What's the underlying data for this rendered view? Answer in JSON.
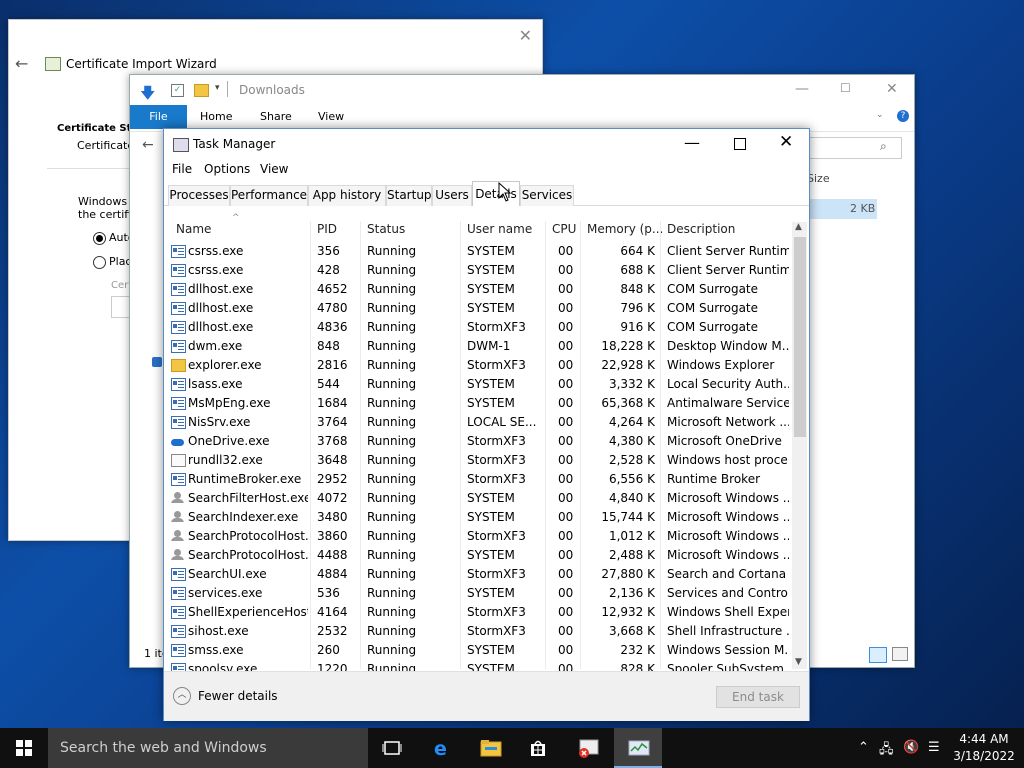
{
  "wizard": {
    "title": "Certificate Import Wizard",
    "store_heading": "Certificate Stor",
    "store_sub": "Certificate",
    "desc1": "Windows c",
    "desc2": "the certific",
    "option_auto": "Auto",
    "option_place": "Place",
    "cert_label": "Cert"
  },
  "explorer": {
    "title": "Downloads",
    "tabs": [
      "File",
      "Home",
      "Share",
      "View"
    ],
    "size_header": "Size",
    "size_value": "2 KB",
    "status": "1 ite"
  },
  "taskmanager": {
    "title": "Task Manager",
    "menu": [
      "File",
      "Options",
      "View"
    ],
    "tabs": [
      "Processes",
      "Performance",
      "App history",
      "Startup",
      "Users",
      "Details",
      "Services"
    ],
    "active_tab": "Details",
    "columns": [
      "Name",
      "PID",
      "Status",
      "User name",
      "CPU",
      "Memory (p...",
      "Description"
    ],
    "rows": [
      {
        "name": "csrss.exe",
        "pid": "356",
        "status": "Running",
        "user": "SYSTEM",
        "cpu": "00",
        "mem": "664 K",
        "desc": "Client Server Runtim...",
        "icon": "window"
      },
      {
        "name": "csrss.exe",
        "pid": "428",
        "status": "Running",
        "user": "SYSTEM",
        "cpu": "00",
        "mem": "688 K",
        "desc": "Client Server Runtim...",
        "icon": "window"
      },
      {
        "name": "dllhost.exe",
        "pid": "4652",
        "status": "Running",
        "user": "SYSTEM",
        "cpu": "00",
        "mem": "848 K",
        "desc": "COM Surrogate",
        "icon": "window"
      },
      {
        "name": "dllhost.exe",
        "pid": "4780",
        "status": "Running",
        "user": "SYSTEM",
        "cpu": "00",
        "mem": "796 K",
        "desc": "COM Surrogate",
        "icon": "window"
      },
      {
        "name": "dllhost.exe",
        "pid": "4836",
        "status": "Running",
        "user": "StormXF3",
        "cpu": "00",
        "mem": "916 K",
        "desc": "COM Surrogate",
        "icon": "window"
      },
      {
        "name": "dwm.exe",
        "pid": "848",
        "status": "Running",
        "user": "DWM-1",
        "cpu": "00",
        "mem": "18,228 K",
        "desc": "Desktop Window M...",
        "icon": "window"
      },
      {
        "name": "explorer.exe",
        "pid": "2816",
        "status": "Running",
        "user": "StormXF3",
        "cpu": "00",
        "mem": "22,928 K",
        "desc": "Windows Explorer",
        "icon": "explorer"
      },
      {
        "name": "lsass.exe",
        "pid": "544",
        "status": "Running",
        "user": "SYSTEM",
        "cpu": "00",
        "mem": "3,332 K",
        "desc": "Local Security Auth...",
        "icon": "window"
      },
      {
        "name": "MsMpEng.exe",
        "pid": "1684",
        "status": "Running",
        "user": "SYSTEM",
        "cpu": "00",
        "mem": "65,368 K",
        "desc": "Antimalware Service...",
        "icon": "window"
      },
      {
        "name": "NisSrv.exe",
        "pid": "3764",
        "status": "Running",
        "user": "LOCAL SE...",
        "cpu": "00",
        "mem": "4,264 K",
        "desc": "Microsoft Network ...",
        "icon": "window"
      },
      {
        "name": "OneDrive.exe",
        "pid": "3768",
        "status": "Running",
        "user": "StormXF3",
        "cpu": "00",
        "mem": "4,380 K",
        "desc": "Microsoft OneDrive",
        "icon": "cloud"
      },
      {
        "name": "rundll32.exe",
        "pid": "3648",
        "status": "Running",
        "user": "StormXF3",
        "cpu": "00",
        "mem": "2,528 K",
        "desc": "Windows host proce...",
        "icon": "doc"
      },
      {
        "name": "RuntimeBroker.exe",
        "pid": "2952",
        "status": "Running",
        "user": "StormXF3",
        "cpu": "00",
        "mem": "6,556 K",
        "desc": "Runtime Broker",
        "icon": "window"
      },
      {
        "name": "SearchFilterHost.exe",
        "pid": "4072",
        "status": "Running",
        "user": "SYSTEM",
        "cpu": "00",
        "mem": "4,840 K",
        "desc": "Microsoft Windows ...",
        "icon": "user"
      },
      {
        "name": "SearchIndexer.exe",
        "pid": "3480",
        "status": "Running",
        "user": "SYSTEM",
        "cpu": "00",
        "mem": "15,744 K",
        "desc": "Microsoft Windows ...",
        "icon": "user"
      },
      {
        "name": "SearchProtocolHost....",
        "pid": "3860",
        "status": "Running",
        "user": "StormXF3",
        "cpu": "00",
        "mem": "1,012 K",
        "desc": "Microsoft Windows ...",
        "icon": "user"
      },
      {
        "name": "SearchProtocolHost....",
        "pid": "4488",
        "status": "Running",
        "user": "SYSTEM",
        "cpu": "00",
        "mem": "2,488 K",
        "desc": "Microsoft Windows ...",
        "icon": "user"
      },
      {
        "name": "SearchUI.exe",
        "pid": "4884",
        "status": "Running",
        "user": "StormXF3",
        "cpu": "00",
        "mem": "27,880 K",
        "desc": "Search and Cortana ...",
        "icon": "window"
      },
      {
        "name": "services.exe",
        "pid": "536",
        "status": "Running",
        "user": "SYSTEM",
        "cpu": "00",
        "mem": "2,136 K",
        "desc": "Services and Control...",
        "icon": "window"
      },
      {
        "name": "ShellExperienceHost....",
        "pid": "4164",
        "status": "Running",
        "user": "StormXF3",
        "cpu": "00",
        "mem": "12,932 K",
        "desc": "Windows Shell Exper...",
        "icon": "window"
      },
      {
        "name": "sihost.exe",
        "pid": "2532",
        "status": "Running",
        "user": "StormXF3",
        "cpu": "00",
        "mem": "3,668 K",
        "desc": "Shell Infrastructure ...",
        "icon": "window"
      },
      {
        "name": "smss.exe",
        "pid": "260",
        "status": "Running",
        "user": "SYSTEM",
        "cpu": "00",
        "mem": "232 K",
        "desc": "Windows Session M...",
        "icon": "window"
      },
      {
        "name": "spoolsv.exe",
        "pid": "1220",
        "status": "Running",
        "user": "SYSTEM",
        "cpu": "00",
        "mem": "828 K",
        "desc": "Spooler SubSystem ...",
        "icon": "window"
      }
    ],
    "fewer_details": "Fewer details",
    "end_task": "End task"
  },
  "taskbar": {
    "search_placeholder": "Search the web and Windows",
    "time": "4:44 AM",
    "date": "3/18/2022"
  }
}
